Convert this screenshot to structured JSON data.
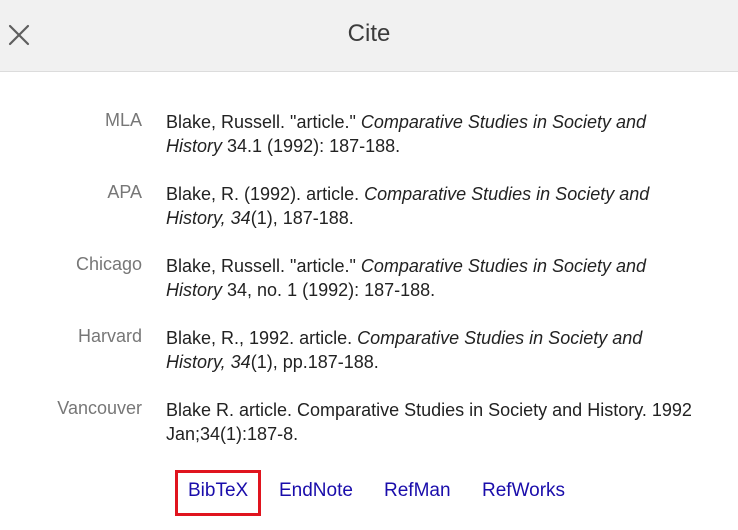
{
  "header": {
    "title": "Cite",
    "close_icon": "close-icon"
  },
  "citations": [
    {
      "style": "MLA",
      "parts": [
        "Blake, Russell. \"article.\" ",
        "Comparative Studies in Society and History",
        " 34.1 (1992): 187-188."
      ]
    },
    {
      "style": "APA",
      "parts": [
        "Blake, R. (1992). article. ",
        "Comparative Studies in Society and History, 34",
        "(1), 187-188."
      ]
    },
    {
      "style": "Chicago",
      "parts": [
        "Blake, Russell. \"article.\" ",
        "Comparative Studies in Society and History",
        " 34, no. 1 (1992): 187-188."
      ]
    },
    {
      "style": "Harvard",
      "parts": [
        "Blake, R., 1992. article. ",
        "Comparative Studies in Society and History, 34",
        "(1), pp.187-188."
      ]
    },
    {
      "style": "Vancouver",
      "parts": [
        "Blake R. article. Comparative Studies in Society and History. 1992 Jan;34(1):187-8.",
        "",
        ""
      ]
    }
  ],
  "export_links": [
    "BibTeX",
    "EndNote",
    "RefMan",
    "RefWorks"
  ],
  "colors": {
    "link": "#1a0dab",
    "highlight": "#e0141e"
  }
}
